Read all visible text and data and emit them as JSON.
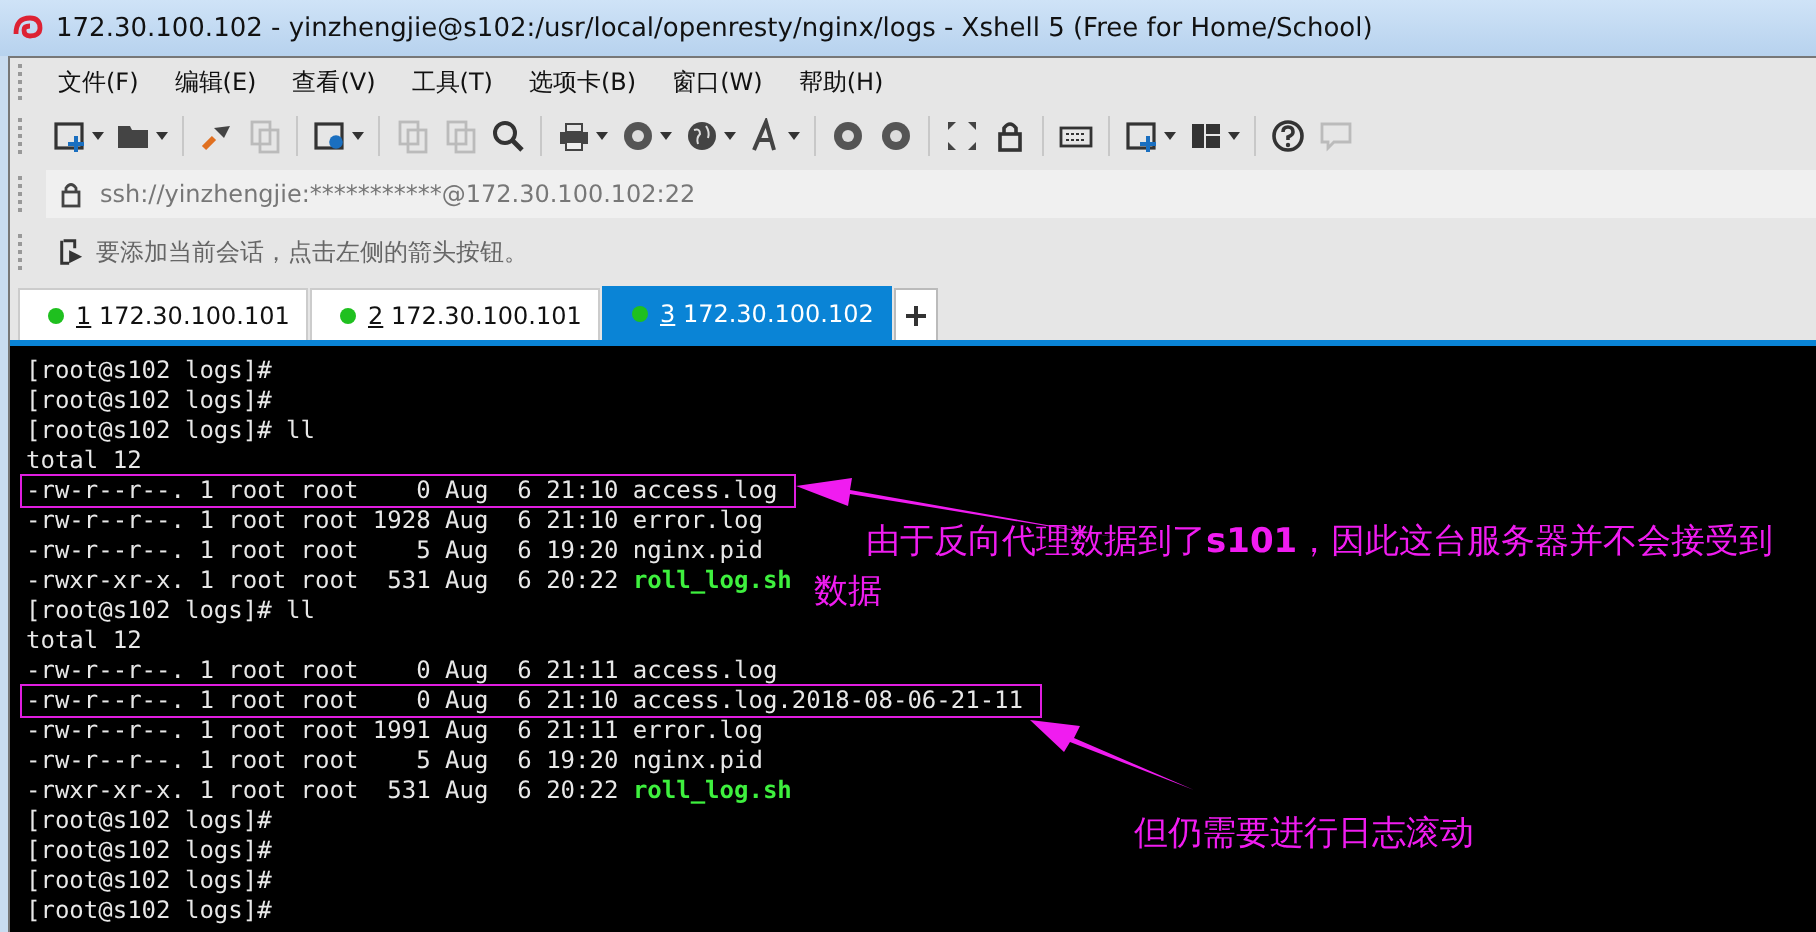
{
  "window": {
    "title": "172.30.100.102 - yinzhengjie@s102:/usr/local/openresty/nginx/logs - Xshell 5 (Free for Home/School)"
  },
  "menu": [
    "文件(F)",
    "编辑(E)",
    "查看(V)",
    "工具(T)",
    "选项卡(B)",
    "窗口(W)",
    "帮助(H)"
  ],
  "address": {
    "value": "ssh://yinzhengjie:***********@172.30.100.102:22"
  },
  "hint": "要添加当前会话，点击左侧的箭头按钮。",
  "tabs": [
    {
      "number": "1",
      "label": "172.30.100.101",
      "selected": false
    },
    {
      "number": "2",
      "label": "172.30.100.101",
      "selected": false
    },
    {
      "number": "3",
      "label": "172.30.100.102",
      "selected": true
    }
  ],
  "terminal": {
    "lines": [
      {
        "text": "[root@s102 logs]#",
        "boxed": false
      },
      {
        "text": "[root@s102 logs]#",
        "boxed": false
      },
      {
        "text": "[root@s102 logs]# ll",
        "boxed": false
      },
      {
        "text": "total 12",
        "boxed": false
      },
      {
        "text": "-rw-r--r--. 1 root root    0 Aug  6 21:10 access.log",
        "boxed": true
      },
      {
        "text": "-rw-r--r--. 1 root root 1928 Aug  6 21:10 error.log",
        "boxed": false
      },
      {
        "text": "-rw-r--r--. 1 root root    5 Aug  6 19:20 nginx.pid",
        "boxed": false
      },
      {
        "text": "-rwxr-xr-x. 1 root root  531 Aug  6 20:22 ",
        "file": "roll_log.sh",
        "boxed": false
      },
      {
        "text": "[root@s102 logs]# ll",
        "boxed": false
      },
      {
        "text": "total 12",
        "boxed": false
      },
      {
        "text": "-rw-r--r--. 1 root root    0 Aug  6 21:11 access.log",
        "boxed": false
      },
      {
        "text": "-rw-r--r--. 1 root root    0 Aug  6 21:10 access.log.2018-08-06-21-11",
        "boxed": true
      },
      {
        "text": "-rw-r--r--. 1 root root 1991 Aug  6 21:11 error.log",
        "boxed": false
      },
      {
        "text": "-rw-r--r--. 1 root root    5 Aug  6 19:20 nginx.pid",
        "boxed": false
      },
      {
        "text": "-rwxr-xr-x. 1 root root  531 Aug  6 20:22 ",
        "file": "roll_log.sh",
        "boxed": false
      },
      {
        "text": "[root@s102 logs]#",
        "boxed": false
      },
      {
        "text": "[root@s102 logs]#",
        "boxed": false
      },
      {
        "text": "[root@s102 logs]#",
        "boxed": false
      },
      {
        "text": "[root@s102 logs]#",
        "boxed": false
      }
    ],
    "annotations": [
      "由于反向代理数据到了**s101**，因此这台服务器并不会接受到数据",
      "但仍需要进行日志滚动"
    ]
  }
}
